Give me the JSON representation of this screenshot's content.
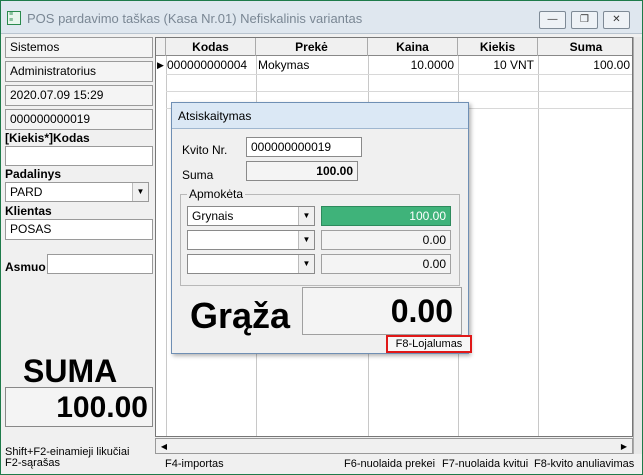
{
  "window": {
    "title": "POS pardavimo taškas (Kasa Nr.01) Nefiskalinis variantas",
    "minimize_glyph": "—",
    "restore_glyph": "❐",
    "close_glyph": "✕"
  },
  "left_panel": {
    "system": "Sistemos",
    "user": "Administratorius",
    "datetime": "2020.07.09 15:29",
    "receipt_number": "000000000019",
    "qty_code_label": "[Kiekis*]Kodas",
    "qty_code_value": "",
    "department_label": "Padalinys",
    "department_value": "PARD",
    "client_label": "Klientas",
    "client_value": "POSAS",
    "person_label": "Asmuo",
    "person_value": "",
    "total_label": "SUMA",
    "total_value": "100.00"
  },
  "grid": {
    "columns": [
      "Kodas",
      "Prekė",
      "Kaina",
      "Kiekis",
      "Suma"
    ],
    "rows": [
      {
        "indicator": "▶",
        "code": "000000000004",
        "item": "Mokymas",
        "price": "10.0000",
        "qty": "10 VNT",
        "sum": "100.00"
      }
    ]
  },
  "dialog": {
    "title": "Atsiskaitymas",
    "receipt_label": "Kvito Nr.",
    "receipt_value": "000000000019",
    "sum_label": "Suma",
    "sum_value": "100.00",
    "paid_legend": "Apmokėta",
    "payments": [
      {
        "method": "Grynais",
        "amount": "100.00"
      },
      {
        "method": "",
        "amount": "0.00"
      },
      {
        "method": "",
        "amount": "0.00"
      }
    ],
    "change_label": "Grąža",
    "change_value": "0.00",
    "loyalty_button": "F8-Lojalumas"
  },
  "status_bar": {
    "hint_line1": "Shift+F2-einamieji likučiai",
    "hint_line2": "F2-sąrašas",
    "f4": "F4-importas",
    "f6": "F6-nuolaida prekei",
    "f7": "F7-nuolaida kvitui",
    "f8": "F8-kvito anuliavimas"
  },
  "colors": {
    "accent_green": "#3fb37a",
    "highlight_red": "#e01818"
  }
}
